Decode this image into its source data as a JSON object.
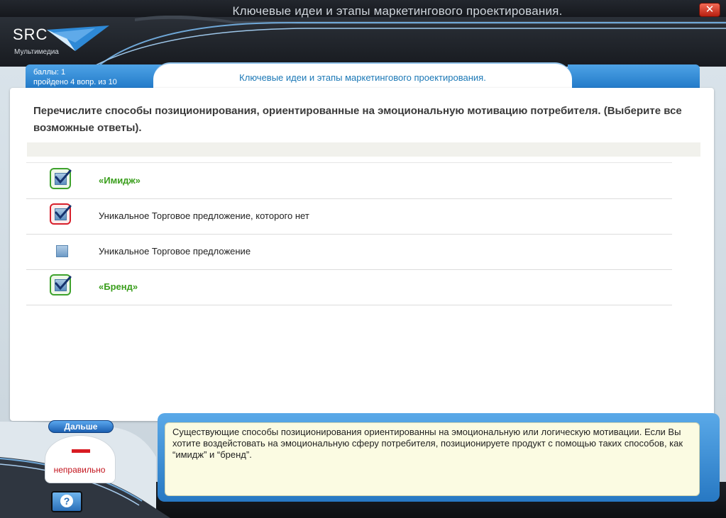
{
  "window": {
    "title": "Ключевые идеи и этапы маркетингового проектирования.",
    "close_glyph": "✕"
  },
  "logo": {
    "brand": "SRC",
    "subtitle": "Мультимедиа"
  },
  "score": {
    "points_line": "баллы: 1",
    "progress_line": "пройдено  4  вопр. из  10"
  },
  "lesson": {
    "title": "Ключевые идеи и этапы маркетингового проектирования."
  },
  "question": {
    "text": "Перечислите способы позиционирования, ориентированные на эмоциональную мотивацию потребителя. (Выберите все возможные ответы)."
  },
  "options": [
    {
      "label": "«Имидж»",
      "checked": true,
      "status": "correct"
    },
    {
      "label": "Уникальное Торговое предложение, которого нет",
      "checked": true,
      "status": "wrong"
    },
    {
      "label": "Уникальное Торговое предложение",
      "checked": false,
      "status": "none"
    },
    {
      "label": "«Бренд»",
      "checked": true,
      "status": "correct"
    }
  ],
  "controls": {
    "next_label": "Дальше",
    "help_glyph": "?"
  },
  "result": {
    "label": "неправильно"
  },
  "feedback": {
    "text": " Существующие способы позиционирования ориентированны на эмоциональную или логическую мотивации. Если Вы хотите воздейстовать на эмоциональную сферу потребителя, позиционируете продукт с помощью таких способов, как “имидж” и “бренд”."
  },
  "colors": {
    "accent_blue": "#1f77c6",
    "correct_green": "#3a9e1c",
    "wrong_red": "#d71f2b",
    "feedback_bg": "#fbfbe2"
  }
}
